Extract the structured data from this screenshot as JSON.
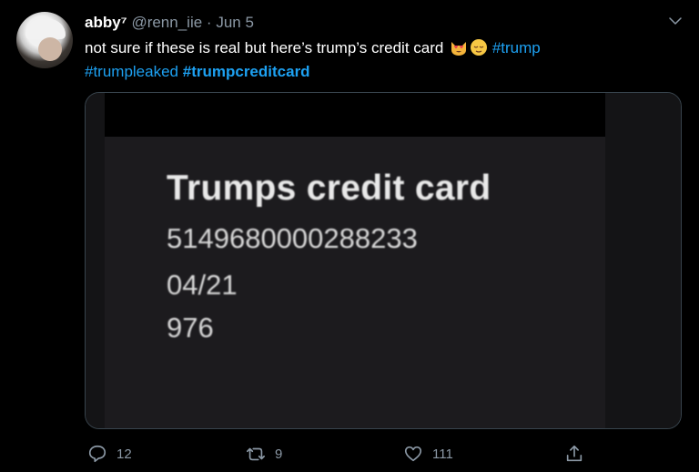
{
  "tweet": {
    "display_name": "abby⁷",
    "handle": "@renn_iie",
    "separator": "·",
    "date": "Jun 5",
    "text_line1": "not sure if these is real but here’s trump’s credit card",
    "hashtag1": "#trump",
    "hashtag2": "#trumpleaked",
    "hashtag3": "#trumpcreditcard",
    "emojis": [
      "heart-eyes-cat-emoji",
      "relieved-face-emoji"
    ]
  },
  "media": {
    "card_title": "Trumps credit card",
    "card_number": "5149680000288233",
    "card_expiry": "04/21",
    "card_cvv": "976"
  },
  "actions": {
    "reply_count": "12",
    "retweet_count": "9",
    "like_count": "111"
  },
  "colors": {
    "background": "#000000",
    "link": "#1da1f2",
    "muted": "#8b98a5",
    "border": "#38444d"
  }
}
